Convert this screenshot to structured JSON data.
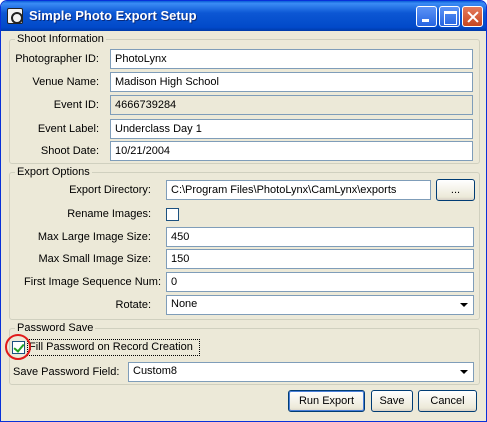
{
  "window": {
    "title": "Simple Photo Export Setup"
  },
  "shoot_info": {
    "legend": "Shoot Information",
    "photographer_id_label": "Photographer ID:",
    "photographer_id_value": "PhotoLynx",
    "venue_name_label": "Venue Name:",
    "venue_name_value": "Madison High School",
    "event_id_label": "Event ID:",
    "event_id_value": "4666739284",
    "event_label_label": "Event Label:",
    "event_label_value": "Underclass Day 1",
    "shoot_date_label": "Shoot Date:",
    "shoot_date_value": "10/21/2004"
  },
  "export_options": {
    "legend": "Export Options",
    "export_dir_label": "Export Directory:",
    "export_dir_value": "C:\\Program Files\\PhotoLynx\\CamLynx\\exports",
    "browse_label": "...",
    "rename_label": "Rename Images:",
    "rename_checked": false,
    "max_large_label": "Max Large Image Size:",
    "max_large_value": "450",
    "max_small_label": "Max Small Image Size:",
    "max_small_value": "150",
    "first_seq_label": "First Image Sequence Num:",
    "first_seq_value": "0",
    "rotate_label": "Rotate:",
    "rotate_value": "None"
  },
  "password_save": {
    "legend": "Password Save",
    "fill_password_label": "Fill Password on Record Creation",
    "fill_password_checked": true,
    "save_field_label": "Save Password Field:",
    "save_field_value": "Custom8"
  },
  "buttons": {
    "run_export": "Run Export",
    "save": "Save",
    "cancel": "Cancel"
  },
  "colors": {
    "titlebar": "#0149c9",
    "dialog_bg": "#ece9d8",
    "annotation_circle": "#e11a1a"
  }
}
